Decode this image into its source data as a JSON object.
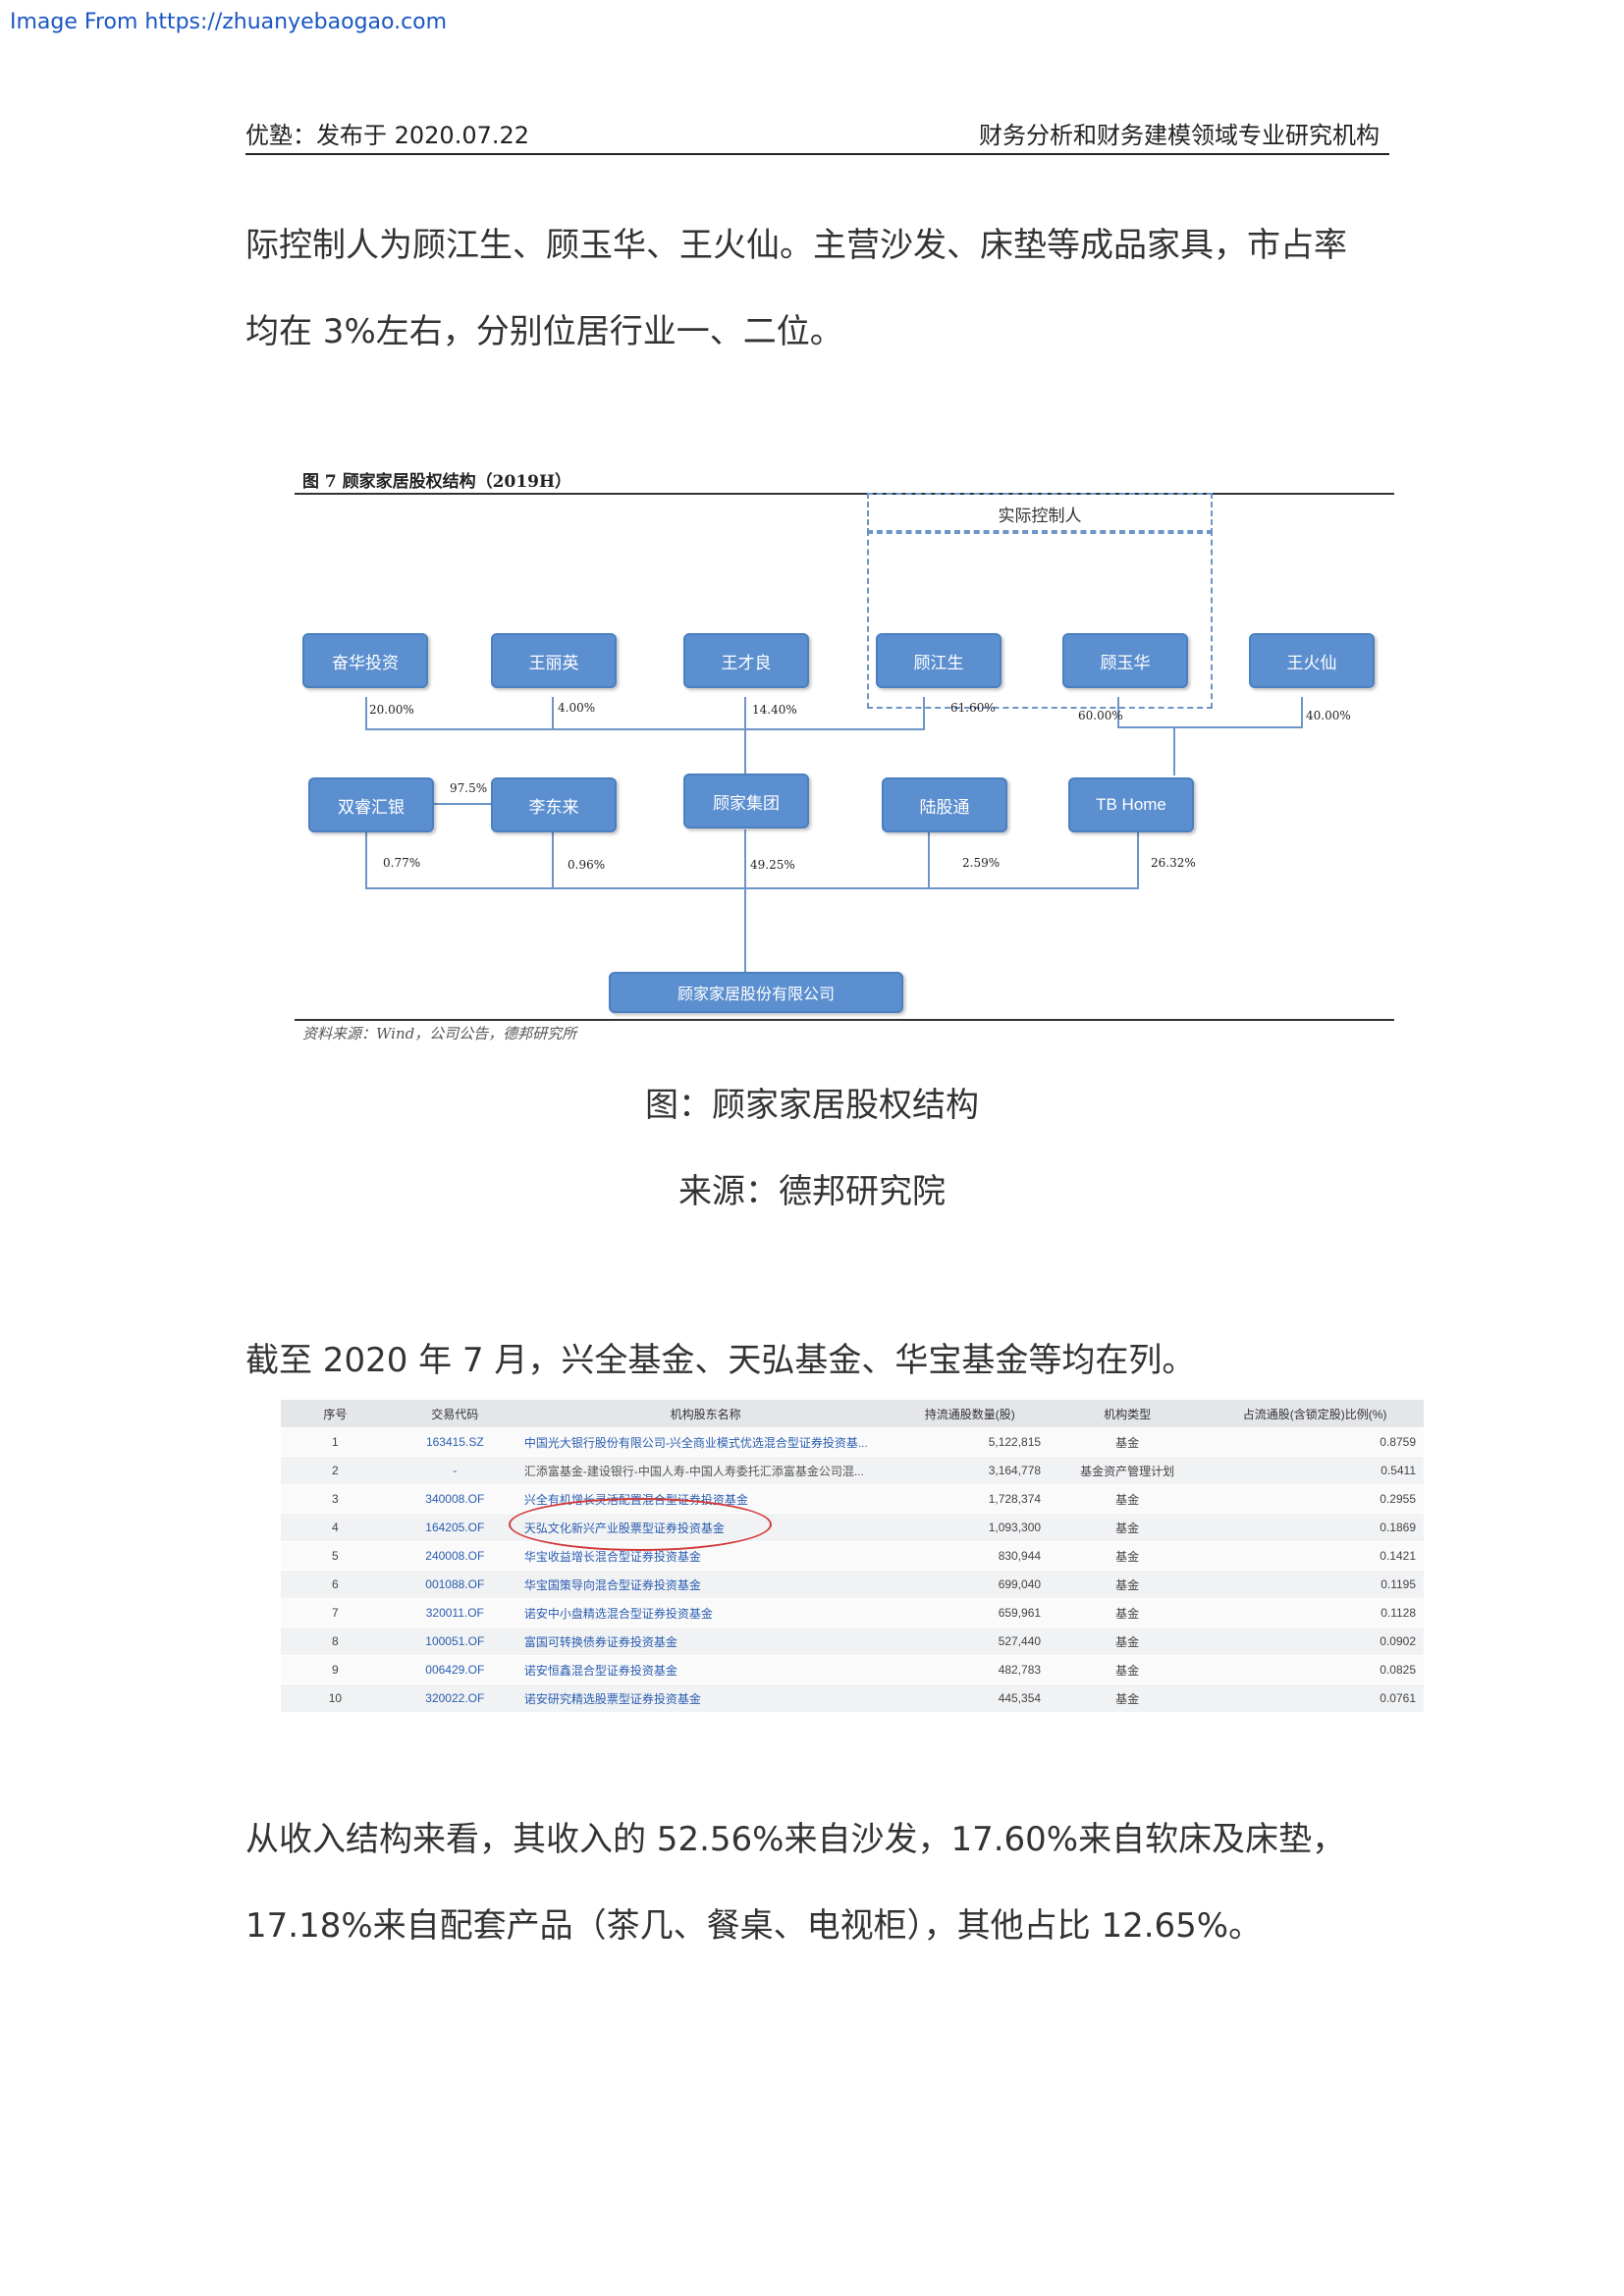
{
  "source_link": "Image From https://zhuanyebaogao.com",
  "header": {
    "left": "优塾：发布于 2020.07.22",
    "right": "财务分析和财务建模领域专业研究机构"
  },
  "paragraphs": {
    "p1": "际控制人为顾江生、顾玉华、王火仙。主营沙发、床垫等成品家具，市占率",
    "p2": "均在 3%左右，分别位居行业一、二位。",
    "p3": "截至 2020 年 7 月，兴全基金、天弘基金、华宝基金等均在列。",
    "p4": "从收入结构来看，其收入的 52.56%来自沙发，17.60%来自软床及床垫，",
    "p5": "17.18%来自配套产品（茶几、餐桌、电视柜），其他占比 12.65%。"
  },
  "figure": {
    "title": "图 7 顾家家居股权结构（2019H）",
    "source": "资料来源：Wind，公司公告，德邦研究所",
    "controller_label": "实际控制人",
    "nodes": {
      "fenhua": "奋华投资",
      "wangliying": "王丽英",
      "wangcailiang": "王才良",
      "gujiangsheng": "顾江生",
      "guyuhua": "顾玉华",
      "wanghuoxian": "王火仙",
      "shuangrui": "双睿汇银",
      "lidonglai": "李东来",
      "gujiagroup": "顾家集团",
      "lugutong": "陆股通",
      "tbhome": "TB Home",
      "company": "顾家家居股份有限公司"
    },
    "pcts": {
      "fenhua": "20.00%",
      "wangliying": "4.00%",
      "wangcailiang": "14.40%",
      "gujiangsheng": "61.60%",
      "guyuhua": "60.00%",
      "wanghuoxian": "40.00%",
      "li_to_shuangrui": "97.5%",
      "shuangrui": "0.77%",
      "lidonglai": "0.96%",
      "gujiagroup": "49.25%",
      "lugutong": "2.59%",
      "tbhome": "26.32%"
    }
  },
  "captions": {
    "fig_caption": "图：顾家家居股权结构",
    "fig_source": "来源：德邦研究院"
  },
  "table": {
    "headers": [
      "序号",
      "交易代码",
      "机构股东名称",
      "持流通股数量(股)",
      "机构类型",
      "占流通股(含锁定股)比例(%)"
    ],
    "rows": [
      [
        "1",
        "163415.SZ",
        "中国光大银行股份有限公司-兴全商业模式优选混合型证券投资基...",
        "5,122,815",
        "基金",
        "0.8759"
      ],
      [
        "2",
        "-",
        "汇添富基金-建设银行-中国人寿-中国人寿委托汇添富基金公司混...",
        "3,164,778",
        "基金资产管理计划",
        "0.5411"
      ],
      [
        "3",
        "340008.OF",
        "兴全有机增长灵活配置混合型证券投资基金",
        "1,728,374",
        "基金",
        "0.2955"
      ],
      [
        "4",
        "164205.OF",
        "天弘文化新兴产业股票型证券投资基金",
        "1,093,300",
        "基金",
        "0.1869"
      ],
      [
        "5",
        "240008.OF",
        "华宝收益增长混合型证券投资基金",
        "830,944",
        "基金",
        "0.1421"
      ],
      [
        "6",
        "001088.OF",
        "华宝国策导向混合型证券投资基金",
        "699,040",
        "基金",
        "0.1195"
      ],
      [
        "7",
        "320011.OF",
        "诺安中小盘精选混合型证券投资基金",
        "659,961",
        "基金",
        "0.1128"
      ],
      [
        "8",
        "100051.OF",
        "富国可转换债券证券投资基金",
        "527,440",
        "基金",
        "0.0902"
      ],
      [
        "9",
        "006429.OF",
        "诺安恒鑫混合型证券投资基金",
        "482,783",
        "基金",
        "0.0825"
      ],
      [
        "10",
        "320022.OF",
        "诺安研究精选股票型证券投资基金",
        "445,354",
        "基金",
        "0.0761"
      ]
    ]
  }
}
